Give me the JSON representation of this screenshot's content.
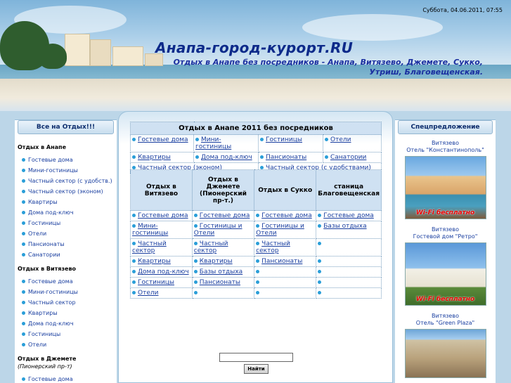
{
  "header": {
    "date": "Суббота, 04.06.2011, 07:55",
    "title": "Анапа-город-курорт.RU",
    "subtitle": "Отдых в Анапе без посредников - Анапа, Витязево, Джемете, Сукко, Утриш, Благовещенская."
  },
  "left_sidebar": {
    "title": "Все на Отдых!!!",
    "groups": [
      {
        "head": "Отдых в Анапе",
        "sub": "",
        "items": [
          "Гостевые дома",
          "Мини-гостиницы",
          "Частный сектор (с удобств.)",
          "Частный сектор (эконом)",
          "Квартиры",
          "Дома под-ключ",
          "Гостиницы",
          "Отели",
          "Пансионаты",
          "Санатории"
        ]
      },
      {
        "head": "Отдых в Витязево",
        "sub": "",
        "items": [
          "Гостевые дома",
          "Мини-гостиницы",
          "Частный сектор",
          "Квартиры",
          "Дома под-ключ",
          "Гостиницы",
          "Отели"
        ]
      },
      {
        "head": "Отдых в Джемете",
        "sub": "(Пионерский пр-т)",
        "items": [
          "Гостевые дома"
        ]
      }
    ]
  },
  "right_sidebar": {
    "title": "Спецпредложение",
    "offers": [
      {
        "place": "Витязево",
        "name": "Отель \"Константинополь\"",
        "photo_text": "Wi-Fi бесплатно"
      },
      {
        "place": "Витязево",
        "name": "Гостевой дом \"Ретро\"",
        "photo_text": "Wi-Fi бесплатно"
      },
      {
        "place": "Витязево",
        "name": "Отель \"Green Plaza\"",
        "photo_text": ""
      }
    ]
  },
  "main": {
    "table1": {
      "header": "Отдых в Анапе 2011 без посредников",
      "rows": [
        [
          "Гостевые дома",
          "Мини-гостиницы",
          "Гостиницы",
          "Отели"
        ],
        [
          "Квартиры",
          "Дома под-ключ",
          "Пансионаты",
          "Санатории"
        ],
        [
          "Частный сектор (эконом)",
          "Частный сектор (с удобствами)"
        ]
      ]
    },
    "table2": {
      "headers": [
        "Отдых в Витязево",
        "Отдых в Джемете (Пионерский пр-т.)",
        "Отдых в Сукко",
        "станица Благовещенская"
      ],
      "rows": [
        [
          "Гостевые дома",
          "Гостевые дома",
          "Гостевые дома",
          "Гостевые дома"
        ],
        [
          "Мини-гостиницы",
          "Гостиницы и Отели",
          "Гостиницы и Отели",
          "Базы отдыха"
        ],
        [
          "Частный сектор",
          "Частный сектор",
          "Частный сектор",
          ""
        ],
        [
          "Квартиры",
          "Квартиры",
          "Пансионаты",
          ""
        ],
        [
          "Дома под-ключ",
          "Базы отдыха",
          "",
          ""
        ],
        [
          "Гостиницы",
          "Пансионаты",
          "",
          ""
        ],
        [
          "Отели",
          "",
          "",
          ""
        ]
      ]
    },
    "search": {
      "button": "Найти",
      "value": ""
    }
  }
}
